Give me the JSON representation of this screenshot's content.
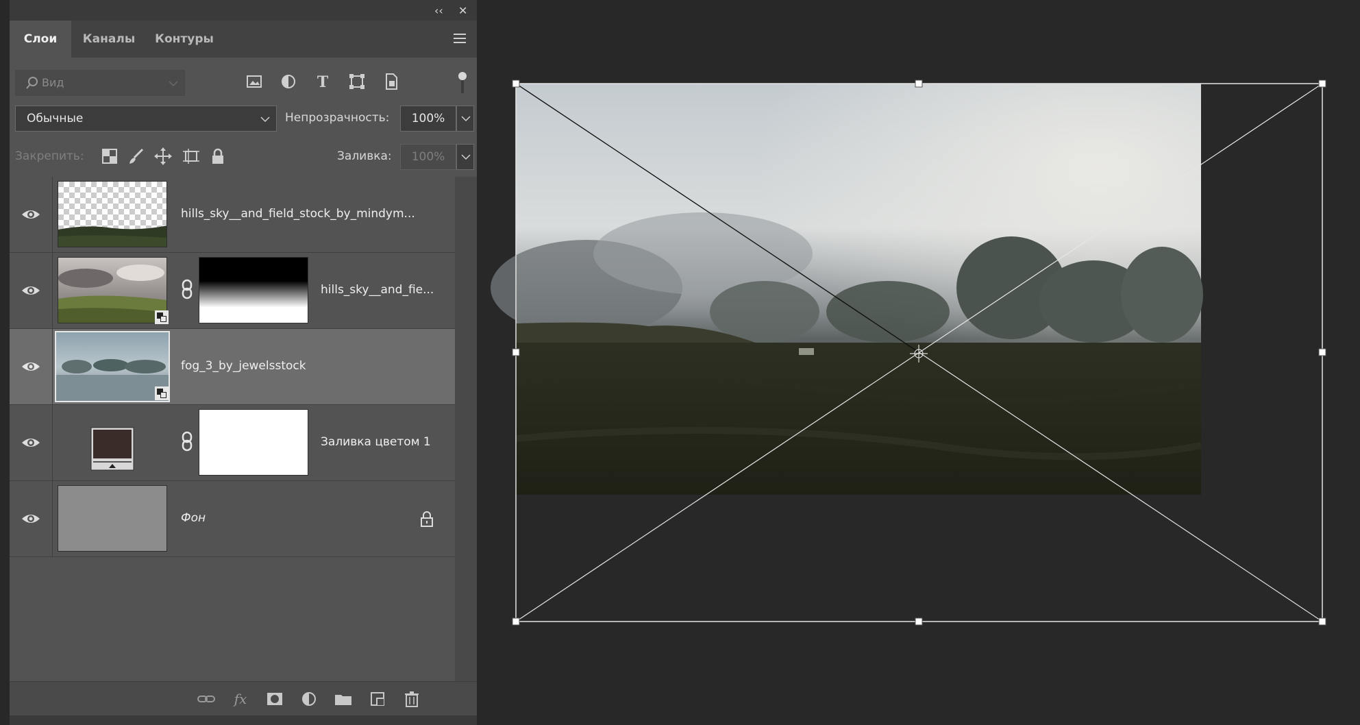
{
  "panel": {
    "collapse_glyph": "‹‹",
    "close_glyph": "✕",
    "tabs": [
      {
        "label": "Слои",
        "active": true
      },
      {
        "label": "Каналы",
        "active": false
      },
      {
        "label": "Контуры",
        "active": false
      }
    ],
    "menu_icon": "panel-menu-icon",
    "search": {
      "placeholder": "Вид",
      "icon": "search-icon"
    },
    "filter_icons": [
      "image-filter-icon",
      "adjustment-filter-icon",
      "type-filter-icon",
      "shape-filter-icon",
      "smart-object-filter-icon"
    ],
    "blend_mode": "Обычные",
    "opacity_label": "Непрозрачность:",
    "opacity_value": "100%",
    "lock_label": "Закрепить:",
    "lock_icons": [
      "lock-transparent-icon",
      "lock-brush-icon",
      "lock-move-icon",
      "lock-artboard-icon",
      "lock-all-icon"
    ],
    "fill_label": "Заливка:",
    "fill_value": "100%",
    "layers": [
      {
        "name": "hills_sky__and_field_stock_by_mindym...",
        "visible": true,
        "selected": false,
        "has_mask": false
      },
      {
        "name": "hills_sky__and_fie...",
        "visible": true,
        "selected": false,
        "has_mask": true,
        "smart_object": true
      },
      {
        "name": "fog_3_by_jewelsstock",
        "visible": true,
        "selected": true,
        "has_mask": false,
        "smart_object": true
      },
      {
        "name": "Заливка цветом 1",
        "visible": true,
        "selected": false,
        "has_mask": true,
        "fill_color": "#3a2c28"
      },
      {
        "name": "Фон",
        "visible": true,
        "selected": false,
        "locked": true,
        "fill_color": "#8c8c8c"
      }
    ],
    "bottom_icons": [
      "link-layers-icon",
      "fx-icon",
      "add-mask-icon",
      "adjustment-layer-icon",
      "group-folder-icon",
      "new-layer-icon",
      "trash-icon"
    ]
  },
  "canvas": {
    "background": "#282828",
    "image": "foggy-hills-photo",
    "transform_box": true
  },
  "colors": {
    "panel_bg": "#535353",
    "selected_row": "#6d6d6d",
    "canvas_bg": "#282828"
  }
}
